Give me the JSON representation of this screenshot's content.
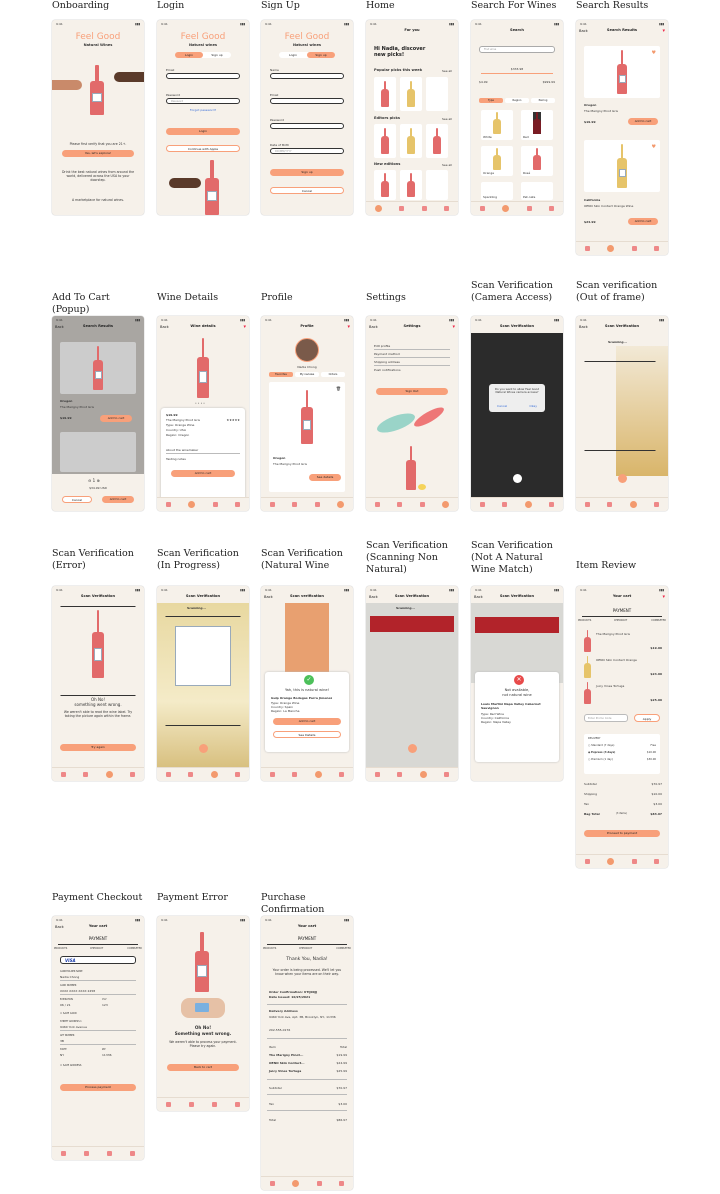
{
  "screens": {
    "onboarding": {
      "title": "Onboarding",
      "time": "9:41",
      "brand": "Feel Good",
      "brand_sub": "Natural Wines",
      "verify": "Please first verify that you are 21+.",
      "cta": "Yes, let's explore!",
      "desc": "Drink the best natural wines from around the world, delivered across the USA to your doorstep.",
      "desc2": "A marketplace for natural wines."
    },
    "login": {
      "title": "Login",
      "time": "9:41",
      "brand": "Feel Good",
      "brand_sub": "Natural wines",
      "tab_login": "Login",
      "tab_signup": "Sign up",
      "email_label": "Email",
      "password_label": "Password",
      "password_placeholder": "Password",
      "forgot": "Forgot password?",
      "login_btn": "Login",
      "apple_btn": "Continue with Apple"
    },
    "signup": {
      "title": "Sign Up",
      "time": "9:41",
      "brand": "Feel Good",
      "brand_sub": "Natural wines",
      "tab_login": "Login",
      "tab_signup": "Sign up",
      "name_label": "Name",
      "email_label": "Email",
      "password_label": "Password",
      "dob_label": "Date of Birth",
      "dob_placeholder": "DD/MM/YYYY",
      "signup_btn": "Sign up",
      "cancel_btn": "Cancel"
    },
    "home": {
      "title": "Home",
      "time": "9:41",
      "header": "For you",
      "greeting": "Hi Nadia, discover new picks!",
      "s1": "Popular picks this week",
      "s2": "Editors picks",
      "s3": "New editions",
      "see_all": "See all"
    },
    "search": {
      "title": "Search For Wines",
      "time": "9:41",
      "header": "Search",
      "placeholder": "Find wine",
      "price_mid": "$333.98",
      "price_min": "$4.99",
      "price_max": "$999.99",
      "chips": [
        "Type",
        "Region",
        "Pairing"
      ],
      "cats": [
        "White",
        "Red",
        "Orange",
        "Rosé",
        "Sparkling",
        "Pet-nats"
      ]
    },
    "results": {
      "title": "Search Results",
      "time": "9:41",
      "header": "Search Results",
      "back": "Back",
      "r1_region": "Oregon",
      "r1_name": "The Marigny Pinot Gris",
      "r1_price": "$19.99",
      "r2_region": "California",
      "r2_name": "OENO Skin Contact Orange Wine",
      "r2_price": "$24.99",
      "add": "Add to cart",
      "usd": "USD"
    },
    "popup": {
      "title": "Add To Cart (Popup)",
      "time": "9:41",
      "header": "Search Results",
      "back": "Back",
      "region": "Oregon",
      "name": "The Marigny Pinot Gris",
      "price": "$19.99",
      "add": "Add to cart",
      "qty": "1",
      "total": "$34.99 USD",
      "cancel": "Cancel",
      "add2": "Add to cart"
    },
    "details": {
      "title": "Wine Details",
      "time": "9:41",
      "header": "Wine details",
      "back": "Back",
      "price": "$19.99",
      "name": "The Marigny Pinot Gris",
      "type": "Type: Orange Wine",
      "country": "Country: USA",
      "region": "Region: Oregon",
      "winemaker": "About the winemaker",
      "notes": "Tasting notes",
      "add": "Add to cart"
    },
    "profile": {
      "title": "Profile",
      "time": "9:41",
      "header": "Profile",
      "name": "Nadia Chong",
      "tabs": [
        "Favorites",
        "My reviews",
        "Orders"
      ],
      "wine_region": "Oregon",
      "wine_name": "The Marigny Pinot Gris",
      "see": "See details"
    },
    "settings": {
      "title": "Settings",
      "time": "9:41",
      "header": "Settings",
      "back": "Back",
      "items": [
        "Edit profile",
        "Payment method",
        "Shipping address",
        "Push notifications"
      ],
      "signout": "Sign Out"
    },
    "camera": {
      "title": "Scan Verification (Camera Access)",
      "time": "9:41",
      "header": "Scan Verification",
      "msg": "Do you want to allow Feel Good Natural Wines camera access?",
      "cancel": "Cancel",
      "okay": "Okay"
    },
    "frame": {
      "title": "Scan verification (Out of frame)",
      "time": "9:41",
      "header": "Scan Verification",
      "back": "Back",
      "status": "Scanning..."
    },
    "error": {
      "title": "Scan Verification (Error)",
      "time": "9:41",
      "header": "Scan Verification",
      "oh": "Oh No!",
      "wrong": "something went wrong.",
      "desc": "We weren't able to read the wine label. Try taking the picture again within the frame.",
      "again": "Try again"
    },
    "progress": {
      "title": "Scan Verification (In Progress)",
      "time": "9:41",
      "header": "Scan Verification",
      "status": "Scanning..."
    },
    "match": {
      "title": "Scan Verification (Natural Wine Match)",
      "time": "9:41",
      "header": "Scan verification",
      "back": "Back",
      "yah": "Yah, this is natural wine!",
      "name": "Gulp Orange Bodegas Parra Jimenez",
      "type": "Type: Orange Wine",
      "country": "Country: Spain",
      "region": "Region: La Mancha",
      "add": "Add to cart",
      "see": "See Details"
    },
    "scan_non": {
      "title": "Scan Verification (Scanning Non Natural)",
      "time": "9:41",
      "header": "Scan Verification",
      "back": "Back",
      "status": "Scanning..."
    },
    "nomatch": {
      "title": "Scan Verification (Not A Natural Wine Match)",
      "time": "9:41",
      "header": "Scan Verification",
      "back": "Back",
      "na": "Not available,",
      "nn": "not natural wine",
      "name": "Louis Martini Napa Valley Cabernet Sauvignon",
      "type": "Type: Red Wine",
      "country": "Country: California",
      "region": "Region: Napa Valley"
    },
    "review": {
      "title": "Item Review",
      "time": "9:41",
      "header": "Your cart",
      "payment": "PAYMENT",
      "steps": [
        "PRODUCTS",
        "CHECKOUT",
        "COMPLETED"
      ],
      "items": [
        {
          "name": "The Marigny Pinot Gris",
          "price": "$19.99"
        },
        {
          "name": "OENO Skin Contact Orange",
          "price": "$24.99"
        },
        {
          "name": "Juicy Vines Tortuga",
          "price": "$25.99"
        }
      ],
      "promo": "Enter Promo Code",
      "apply": "Apply",
      "delivery": "DELIVERY",
      "opts": [
        {
          "name": "Standard (7 days)",
          "price": "Free"
        },
        {
          "name": "Express (3 days)",
          "price": "$10.00"
        },
        {
          "name": "Premium (1 day)",
          "price": "$30.00"
        }
      ],
      "subtotal_l": "Subtotal",
      "subtotal": "$70.97",
      "ship_l": "Shipping",
      "ship": "$10.00",
      "tax_l": "Tax",
      "tax": "$3.00",
      "total_l": "Bag Total",
      "total_items": "(3 items)",
      "total": "$83.97",
      "proceed": "Proceed to payment"
    },
    "checkout": {
      "title": "Payment Checkout",
      "time": "9:41",
      "header": "Your cart",
      "back": "Back",
      "payment": "PAYMENT",
      "steps": [
        "PRODUCTS",
        "CHECKOUT",
        "COMPLETED"
      ],
      "card": "VISA",
      "holder_l": "CARDHOLDER NAME",
      "holder": "Nadia Chong",
      "num_l": "CARD NUMBER",
      "num": "XXXX  XXXX  XXXX  2458",
      "exp_l": "EXPIRATION",
      "exp": "06  /  21",
      "cvv_l": "CVV",
      "cvv": "123",
      "save": "SAVE CARD",
      "street_l": "STREET ADDRESS 1",
      "street": "9460 York Avenue",
      "apt_l": "APT NUMBER",
      "apt": "3B",
      "state_l": "STATE",
      "state": "NY",
      "zip_l": "ZIP",
      "zip": "11336",
      "save_addr": "SAVE ADDRESS",
      "process": "Process payment"
    },
    "payerror": {
      "title": "Payment Error",
      "time": "9:41",
      "oh": "Oh No!",
      "wrong": "Something went wrong.",
      "desc": "We weren't able to process your payment. Please try again.",
      "back": "Back to cart"
    },
    "confirm": {
      "title": "Purchase Confirmation",
      "time": "9:41",
      "header": "Your cart",
      "payment": "PAYMENT",
      "steps": [
        "PRODUCTS",
        "CHECKOUT",
        "COMPLETED"
      ],
      "thanks": "Thank You, Nadia!",
      "desc": "Your order is being processed. We'll let you know when your items are on their way.",
      "order": "Order Confirmation: UTIJ00JJ",
      "date": "Date Issued: 10/25/2021",
      "addr_l": "Delivery Address",
      "addr": "9460 York Ave, Apt. 3B, Brooklyn, NY, 11336",
      "phone": "202-555-0176",
      "item_h": "Item",
      "total_h": "Total",
      "rows": [
        {
          "n": "The Marigny Pinot...",
          "p": "$19.99"
        },
        {
          "n": "OENO Skin Contact...",
          "p": "$24.99"
        },
        {
          "n": "Juicy Vines Tortuga",
          "p": "$25.99"
        }
      ],
      "subtotal_l": "Subtotal",
      "subtotal": "$70.97",
      "tax_l": "Tax",
      "tax": "$3.00",
      "total_l": "Total",
      "total": "$86.97"
    }
  },
  "tabs": [
    "For you",
    "Search",
    "Scan wine",
    "Profile"
  ],
  "colors": {
    "accent": "#f8a07a",
    "bottle": "#e26a6a",
    "bg": "#f6f1ea"
  }
}
